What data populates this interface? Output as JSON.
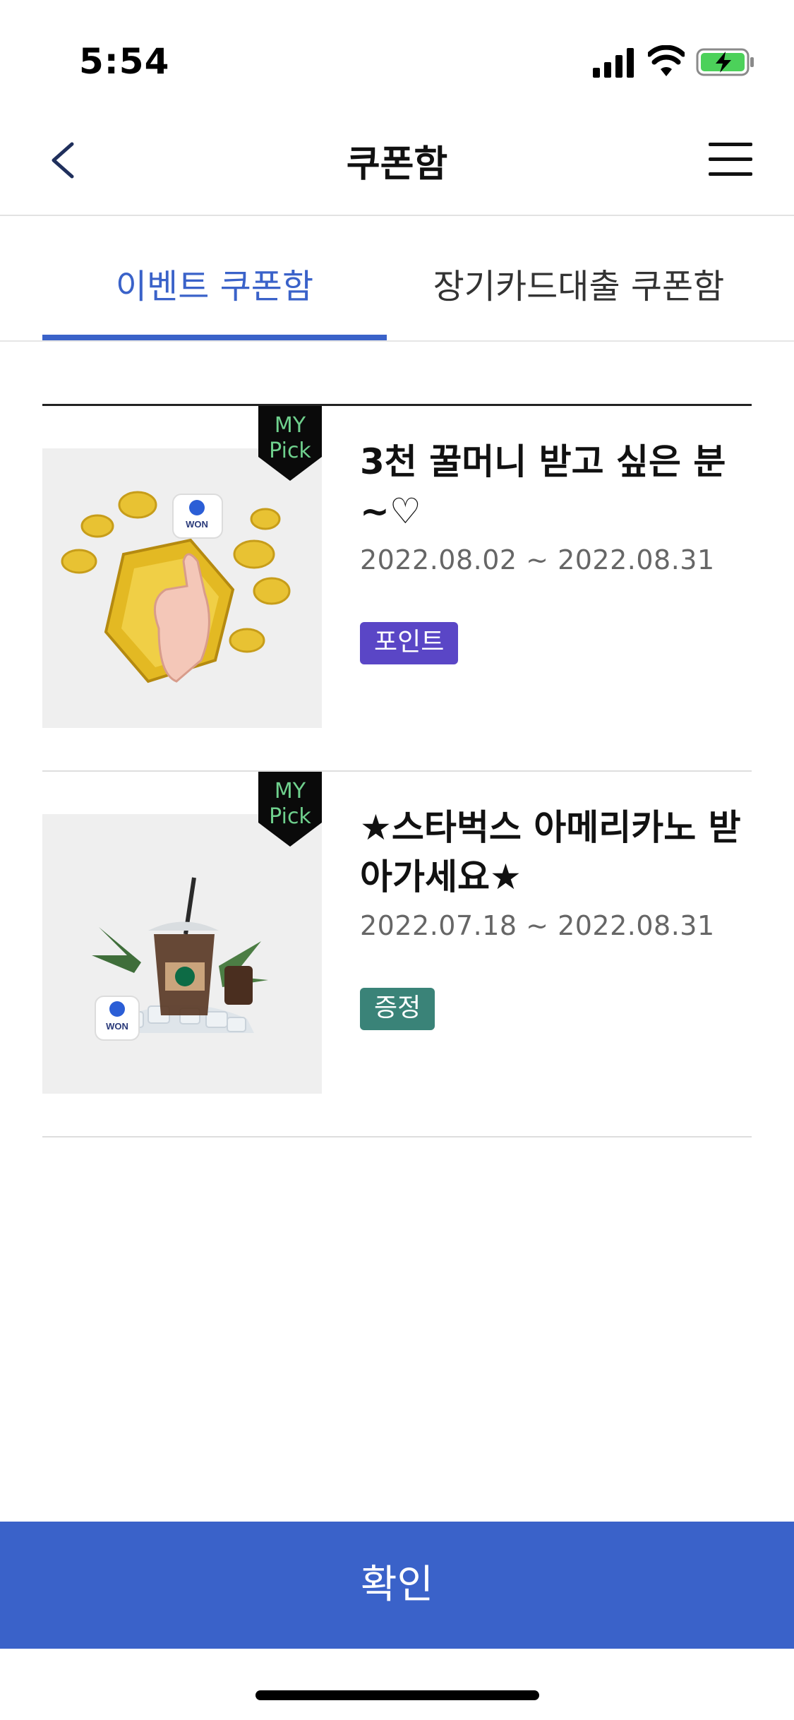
{
  "status_bar": {
    "time": "5:54"
  },
  "nav": {
    "title": "쿠폰함"
  },
  "tabs": [
    {
      "label": "이벤트 쿠폰함",
      "active": true
    },
    {
      "label": "장기카드대출 쿠폰함",
      "active": false
    }
  ],
  "coupons": [
    {
      "mypick_line1": "MY",
      "mypick_line2": "Pick",
      "title": "3천 꿀머니 받고 싶은 분~♡",
      "date": "2022.08.02 ~ 2022.08.31",
      "badge": "포인트",
      "badge_color": "#5a46c6"
    },
    {
      "mypick_line1": "MY",
      "mypick_line2": "Pick",
      "title": "★스타벅스 아메리카노 받아가세요★",
      "date": "2022.07.18 ~ 2022.08.31",
      "badge": "증정",
      "badge_color": "#3a8378"
    }
  ],
  "confirm_button": {
    "label": "확인"
  },
  "colors": {
    "accent": "#3a62c9",
    "point_badge": "#5a46c6",
    "gift_badge": "#3a8378"
  }
}
